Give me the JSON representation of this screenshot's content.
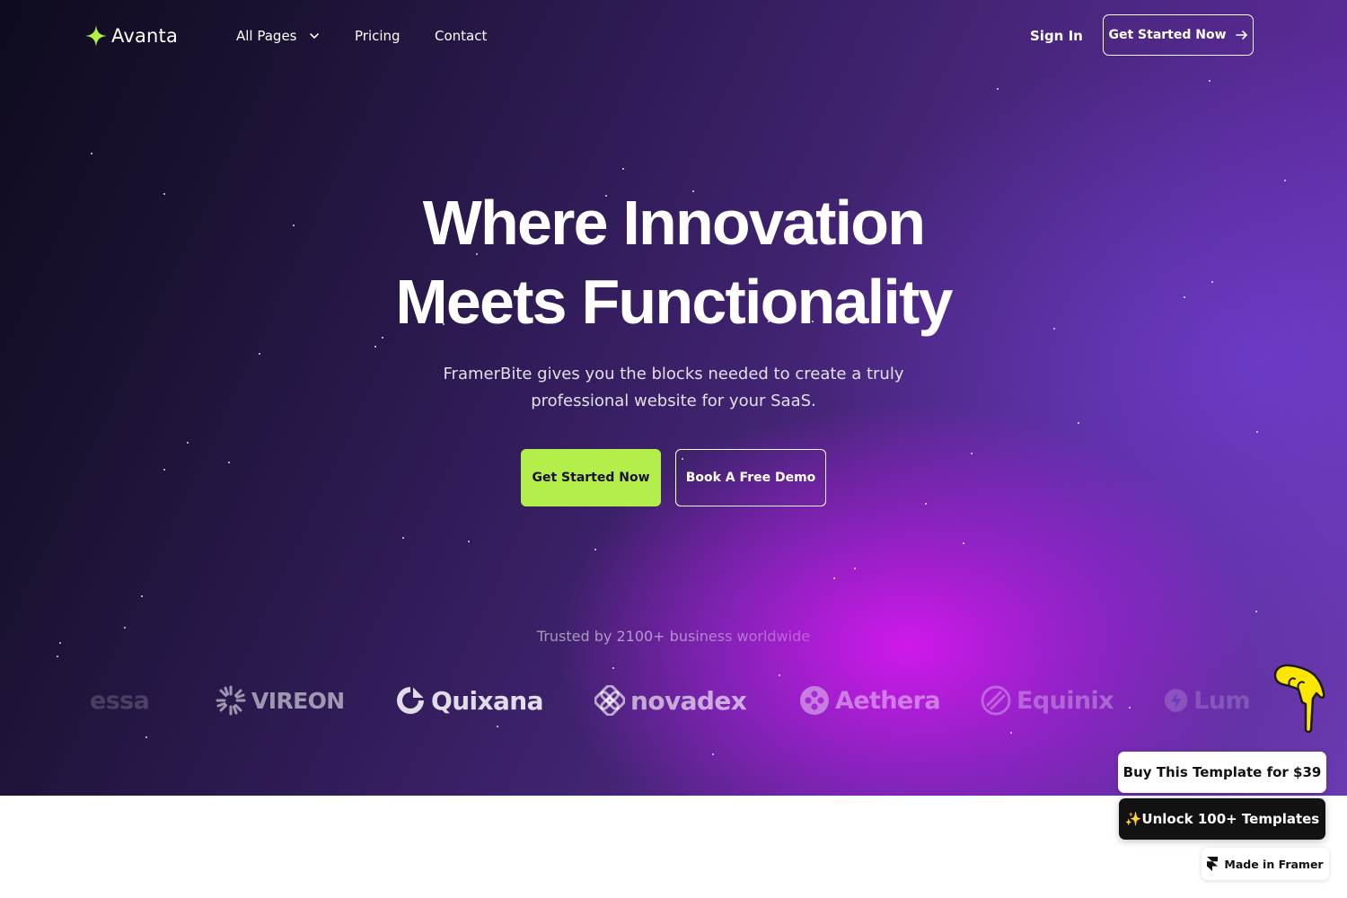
{
  "nav": {
    "brand": "Avanta",
    "links": [
      "All Pages",
      "Pricing",
      "Contact"
    ],
    "sign_in": "Sign In",
    "cta": "Get Started Now"
  },
  "hero": {
    "headline_line1": "Where Innovation",
    "headline_line2": "Meets Functionality",
    "subtitle_line1": "FramerBite gives you the blocks needed to create a truly",
    "subtitle_line2": "professional website for your SaaS.",
    "primary_cta": "Get Started Now",
    "secondary_cta": "Book A Free Demo"
  },
  "trusted": {
    "text": "Trusted by 2100+ business worldwide",
    "logos": [
      "essa",
      "VIREON",
      "Quixana",
      "novadex",
      "Aethera",
      "Equinix",
      "Lum"
    ]
  },
  "floating": {
    "buy": "Buy This Template for $39",
    "unlock": "✨Unlock 100+ Templates",
    "made_in": "Made in Framer"
  },
  "colors": {
    "accent_green": "#b3ee4a",
    "hero_dark": "#1c1233",
    "hero_magenta": "#d618f0"
  },
  "icons": [
    "sparkle-logo-icon",
    "chevron-down-icon",
    "arrow-right-icon",
    "pointing-hand-cursor-icon",
    "framer-icon"
  ]
}
